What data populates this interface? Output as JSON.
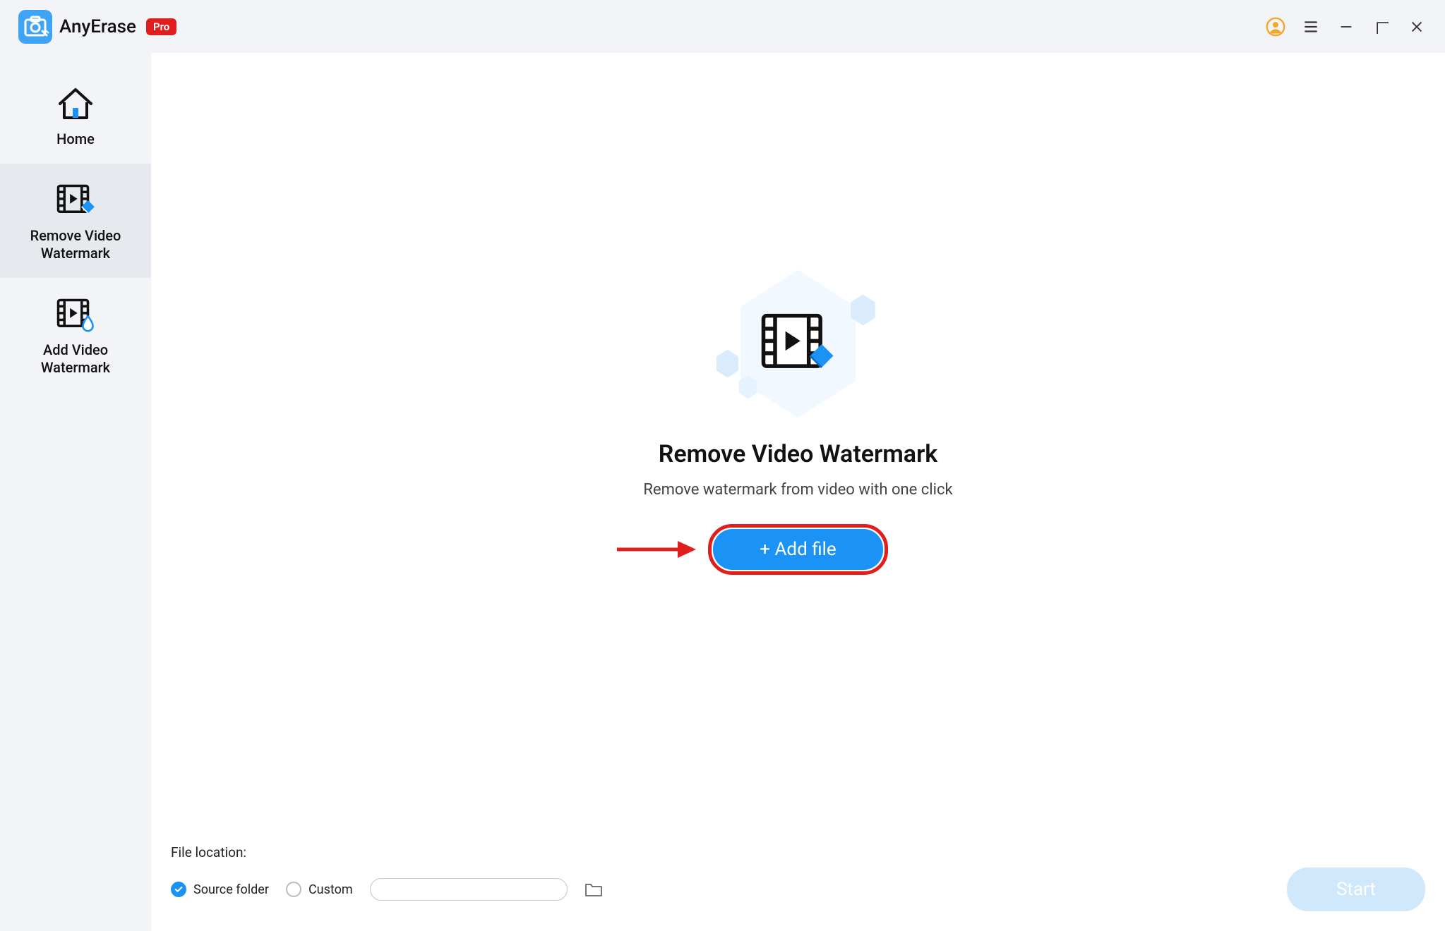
{
  "titlebar": {
    "app_name": "AnyErase",
    "badge": "Pro",
    "icons": {
      "account": "account-icon",
      "menu": "menu-icon",
      "minimize": "minimize-icon",
      "maximize": "maximize-icon",
      "close": "close-icon"
    }
  },
  "sidebar": {
    "items": [
      {
        "label": "Home",
        "icon": "home-icon",
        "active": false
      },
      {
        "label": "Remove Video Watermark",
        "icon": "video-eraser-icon",
        "active": true
      },
      {
        "label": "Add Video Watermark",
        "icon": "video-droplet-icon",
        "active": false
      }
    ]
  },
  "hero": {
    "title": "Remove Video Watermark",
    "subtitle": "Remove watermark from video with one click",
    "add_file_label": "+ Add file"
  },
  "bottom": {
    "file_location_label": "File location:",
    "source_folder_label": "Source folder",
    "custom_label": "Custom",
    "custom_path": "",
    "custom_placeholder": "",
    "start_label": "Start",
    "selected_option": "source"
  },
  "annotation": {
    "arrow_color": "#e11d1d",
    "highlight_border_color": "#e11d1d"
  },
  "colors": {
    "accent": "#1b92f5",
    "badge": "#e11d1d",
    "sidebar_active": "#e6e9ed",
    "app_bg": "#f2f4f8"
  }
}
